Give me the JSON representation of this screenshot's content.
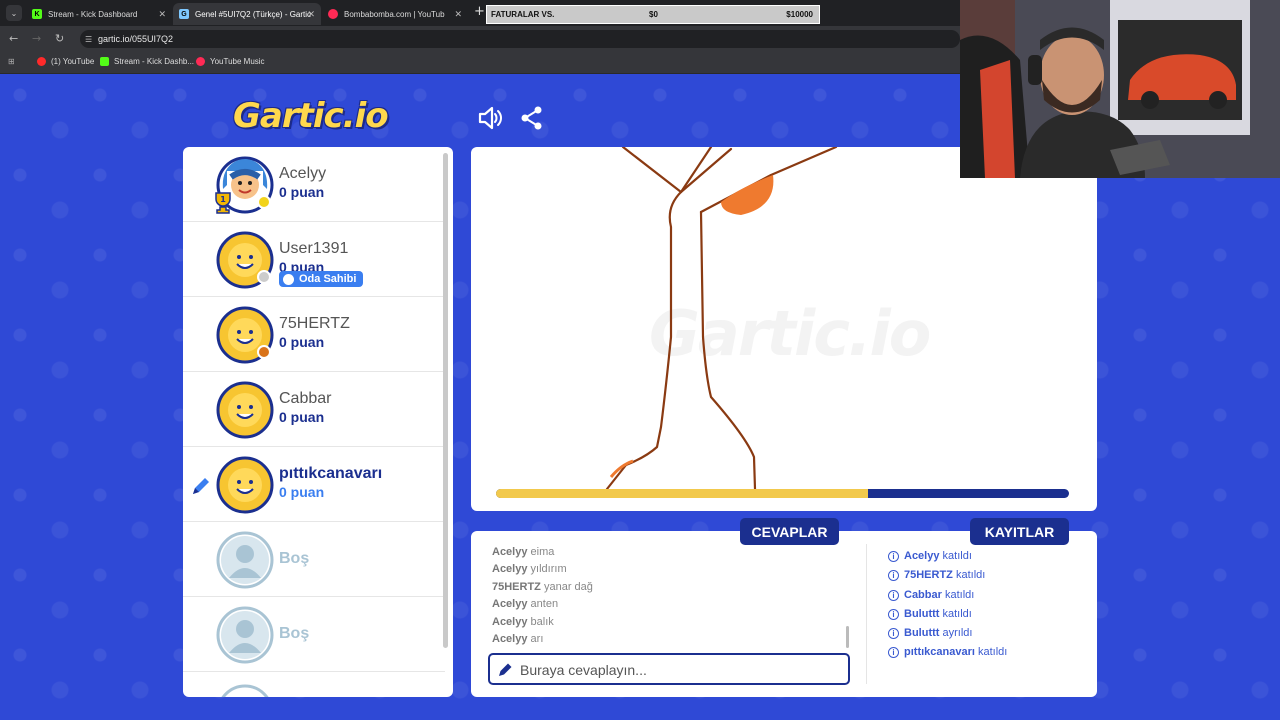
{
  "browser": {
    "tabs": [
      {
        "title": "Stream - Kick Dashboard",
        "icon": "kick-icon",
        "active": false
      },
      {
        "title": "Genel #5UI7Q2 (Türkçe) - Gartic",
        "icon": "gartic-icon",
        "active": true
      },
      {
        "title": "Bombabomba.com | YouTub",
        "icon": "youtube-icon",
        "active": false
      }
    ],
    "url": "gartic.io/055UI7Q2",
    "bookmarks": [
      {
        "label": "(1) YouTube",
        "icon": "youtube-icon"
      },
      {
        "label": "Stream - Kick Dashb...",
        "icon": "kick-icon"
      },
      {
        "label": "YouTube Music",
        "icon": "youtube-music-icon"
      }
    ]
  },
  "overlay": {
    "label": "FATURALAR VS.",
    "current": "$0",
    "goal": "$10000"
  },
  "header": {
    "logo": "Gartic.io"
  },
  "players": [
    {
      "name": "Acelyy",
      "score": "0 puan"
    },
    {
      "name": "User1391",
      "score": "0 puan",
      "badge": "Oda Sahibi"
    },
    {
      "name": "75HERTZ",
      "score": "0 puan"
    },
    {
      "name": "Cabbar",
      "score": "0 puan"
    },
    {
      "name": "pıttıkcanavarı",
      "score": "0 puan"
    },
    {
      "name": "Boş"
    },
    {
      "name": "Boş"
    }
  ],
  "canvas": {
    "watermark": "Gartic.io",
    "timer_progress": 0.65
  },
  "tabs": {
    "answers": "CEVAPLAR",
    "logs": "KAYITLAR"
  },
  "answers": [
    {
      "user": "Acelyy",
      "text": "eima"
    },
    {
      "user": "Acelyy",
      "text": "yıldırım"
    },
    {
      "user": "75HERTZ",
      "text": "yanar dağ"
    },
    {
      "user": "Acelyy",
      "text": "anten"
    },
    {
      "user": "Acelyy",
      "text": "balık"
    },
    {
      "user": "Acelyy",
      "text": "arı"
    }
  ],
  "answer_input": {
    "placeholder": "Buraya cevaplayın..."
  },
  "logs": [
    {
      "user": "Acelyy",
      "action": "katıldı"
    },
    {
      "user": "75HERTZ",
      "action": "katıldı"
    },
    {
      "user": "Cabbar",
      "action": "katıldı"
    },
    {
      "user": "Buluttt",
      "action": "katıldı"
    },
    {
      "user": "Buluttt",
      "action": "ayrıldı"
    },
    {
      "user": "pıttıkcanavarı",
      "action": "katıldı"
    }
  ],
  "colors": {
    "brand_blue": "#2f49d6",
    "navy": "#1b2f8f",
    "yellow": "#f2c94c"
  }
}
